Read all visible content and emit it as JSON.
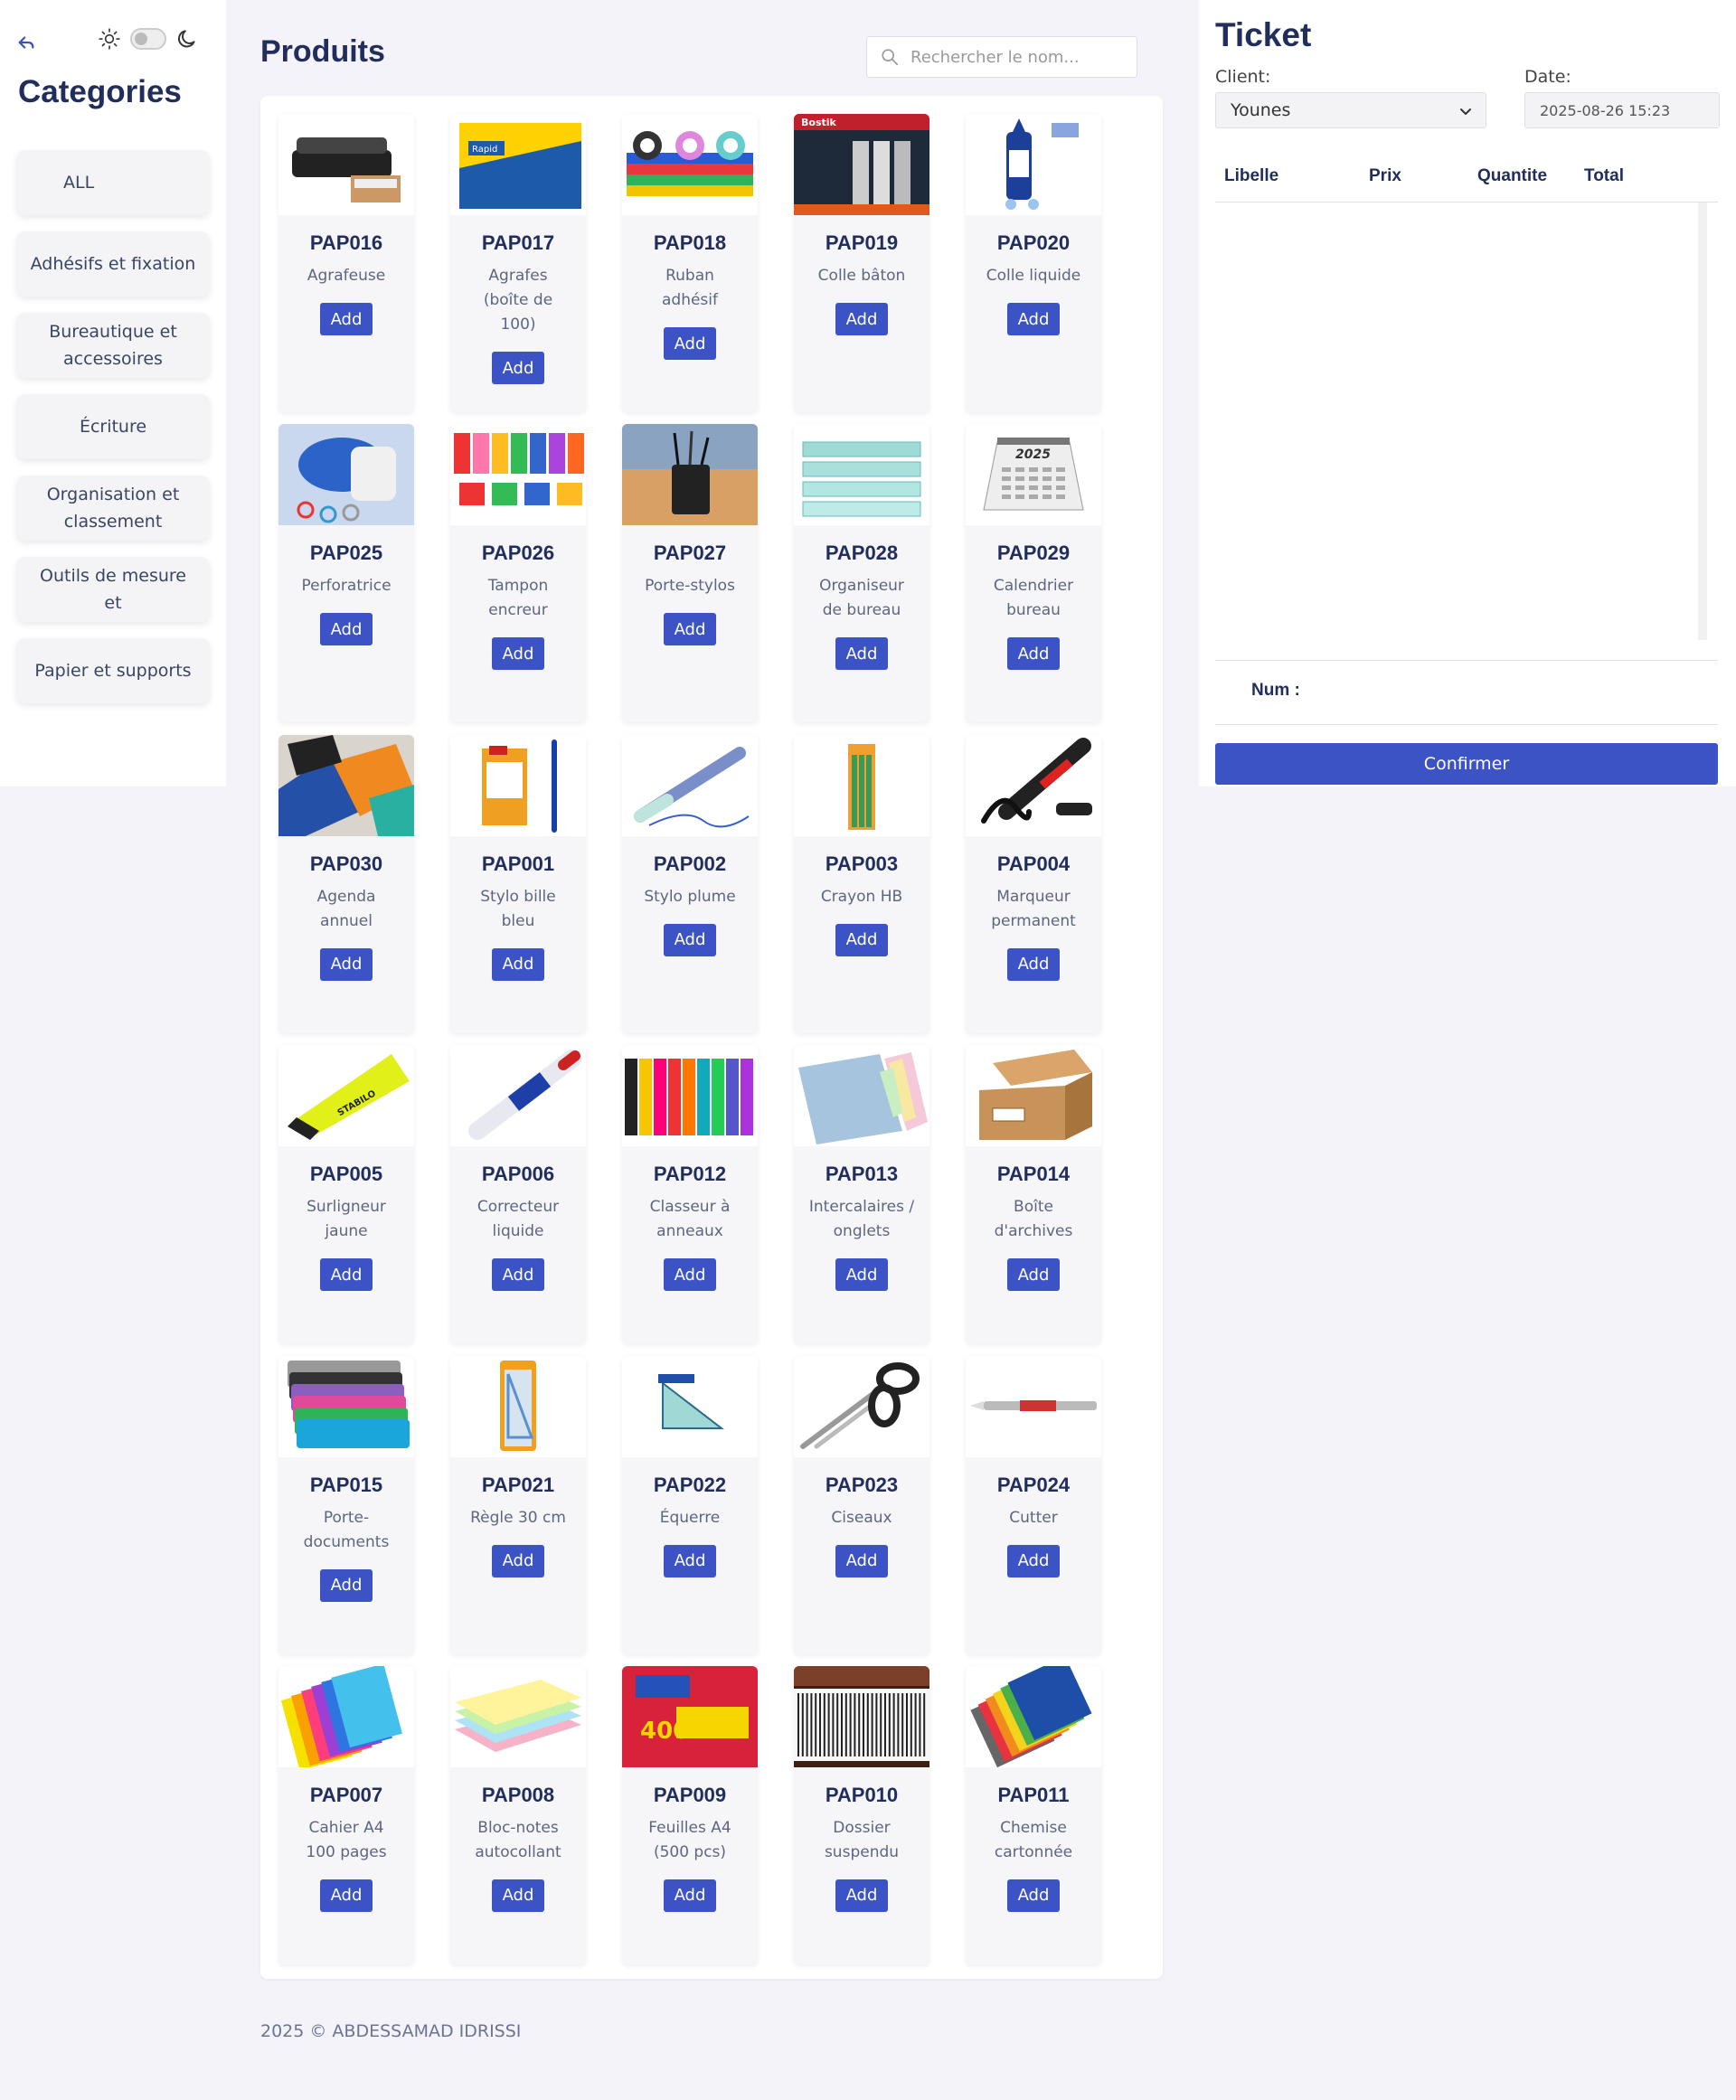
{
  "sidebar": {
    "title": "Categories",
    "categories": [
      {
        "label": "ALL"
      },
      {
        "label": "Adhésifs et fixation"
      },
      {
        "label": "Bureautique et accessoires"
      },
      {
        "label": "Écriture"
      },
      {
        "label": "Organisation et classement"
      },
      {
        "label": "Outils de mesure et"
      },
      {
        "label": "Papier et supports"
      }
    ]
  },
  "products": {
    "title": "Produits",
    "search_placeholder": "Rechercher le nom...",
    "add_label": "Add",
    "items": [
      {
        "code": "PAP016",
        "name": "Agrafeuse",
        "icon": "stapler"
      },
      {
        "code": "PAP017",
        "name": "Agrafes (boîte de 100)",
        "icon": "staples-box"
      },
      {
        "code": "PAP018",
        "name": "Ruban adhésif",
        "icon": "tape-rolls"
      },
      {
        "code": "PAP019",
        "name": "Colle bâton",
        "icon": "glue-sticks"
      },
      {
        "code": "PAP020",
        "name": "Colle liquide",
        "icon": "liquid-glue"
      },
      {
        "code": "PAP025",
        "name": "Perforatrice",
        "icon": "hole-punch"
      },
      {
        "code": "PAP026",
        "name": "Tampon encreur",
        "icon": "ink-pads"
      },
      {
        "code": "PAP027",
        "name": "Porte-stylos",
        "icon": "pen-holder"
      },
      {
        "code": "PAP028",
        "name": "Organiseur de bureau",
        "icon": "desk-organizer"
      },
      {
        "code": "PAP029",
        "name": "Calendrier bureau",
        "icon": "calendar"
      },
      {
        "code": "PAP030",
        "name": "Agenda annuel",
        "icon": "planners"
      },
      {
        "code": "PAP001",
        "name": "Stylo bille bleu",
        "icon": "ballpoint-pen"
      },
      {
        "code": "PAP002",
        "name": "Stylo plume",
        "icon": "fountain-pen"
      },
      {
        "code": "PAP003",
        "name": "Crayon HB",
        "icon": "pencils"
      },
      {
        "code": "PAP004",
        "name": "Marqueur permanent",
        "icon": "marker"
      },
      {
        "code": "PAP005",
        "name": "Surligneur jaune",
        "icon": "highlighter"
      },
      {
        "code": "PAP006",
        "name": "Correcteur liquide",
        "icon": "correction-pen"
      },
      {
        "code": "PAP012",
        "name": "Classeur à anneaux",
        "icon": "binders"
      },
      {
        "code": "PAP013",
        "name": "Intercalaires / onglets",
        "icon": "dividers"
      },
      {
        "code": "PAP014",
        "name": "Boîte d'archives",
        "icon": "archive-box"
      },
      {
        "code": "PAP015",
        "name": "Porte-documents",
        "icon": "envelopes"
      },
      {
        "code": "PAP021",
        "name": "Règle 30 cm",
        "icon": "ruler"
      },
      {
        "code": "PAP022",
        "name": "Équerre",
        "icon": "set-square"
      },
      {
        "code": "PAP023",
        "name": "Ciseaux",
        "icon": "scissors"
      },
      {
        "code": "PAP024",
        "name": "Cutter",
        "icon": "cutter"
      },
      {
        "code": "PAP007",
        "name": "Cahier A4 100 pages",
        "icon": "notebooks"
      },
      {
        "code": "PAP008",
        "name": "Bloc-notes autocollant",
        "icon": "sticky-notes"
      },
      {
        "code": "PAP009",
        "name": "Feuilles A4 (500 pcs)",
        "icon": "paper-pack"
      },
      {
        "code": "PAP010",
        "name": "Dossier suspendu",
        "icon": "hanging-folders"
      },
      {
        "code": "PAP011",
        "name": "Chemise cartonnée",
        "icon": "folders"
      }
    ]
  },
  "ticket": {
    "title": "Ticket",
    "client_label": "Client:",
    "client_value": "Younes",
    "date_label": "Date:",
    "date_value": "2025-08-26 15:23",
    "columns": [
      "Libelle",
      "Prix",
      "Quantite",
      "Total"
    ],
    "num_label": "Num :",
    "confirm_label": "Confirmer"
  },
  "footer": "2025 © ABDESSAMAD IDRISSI",
  "colors": {
    "accent": "#3b53c4",
    "heading": "#212e5c",
    "background": "#f3f3f9"
  }
}
